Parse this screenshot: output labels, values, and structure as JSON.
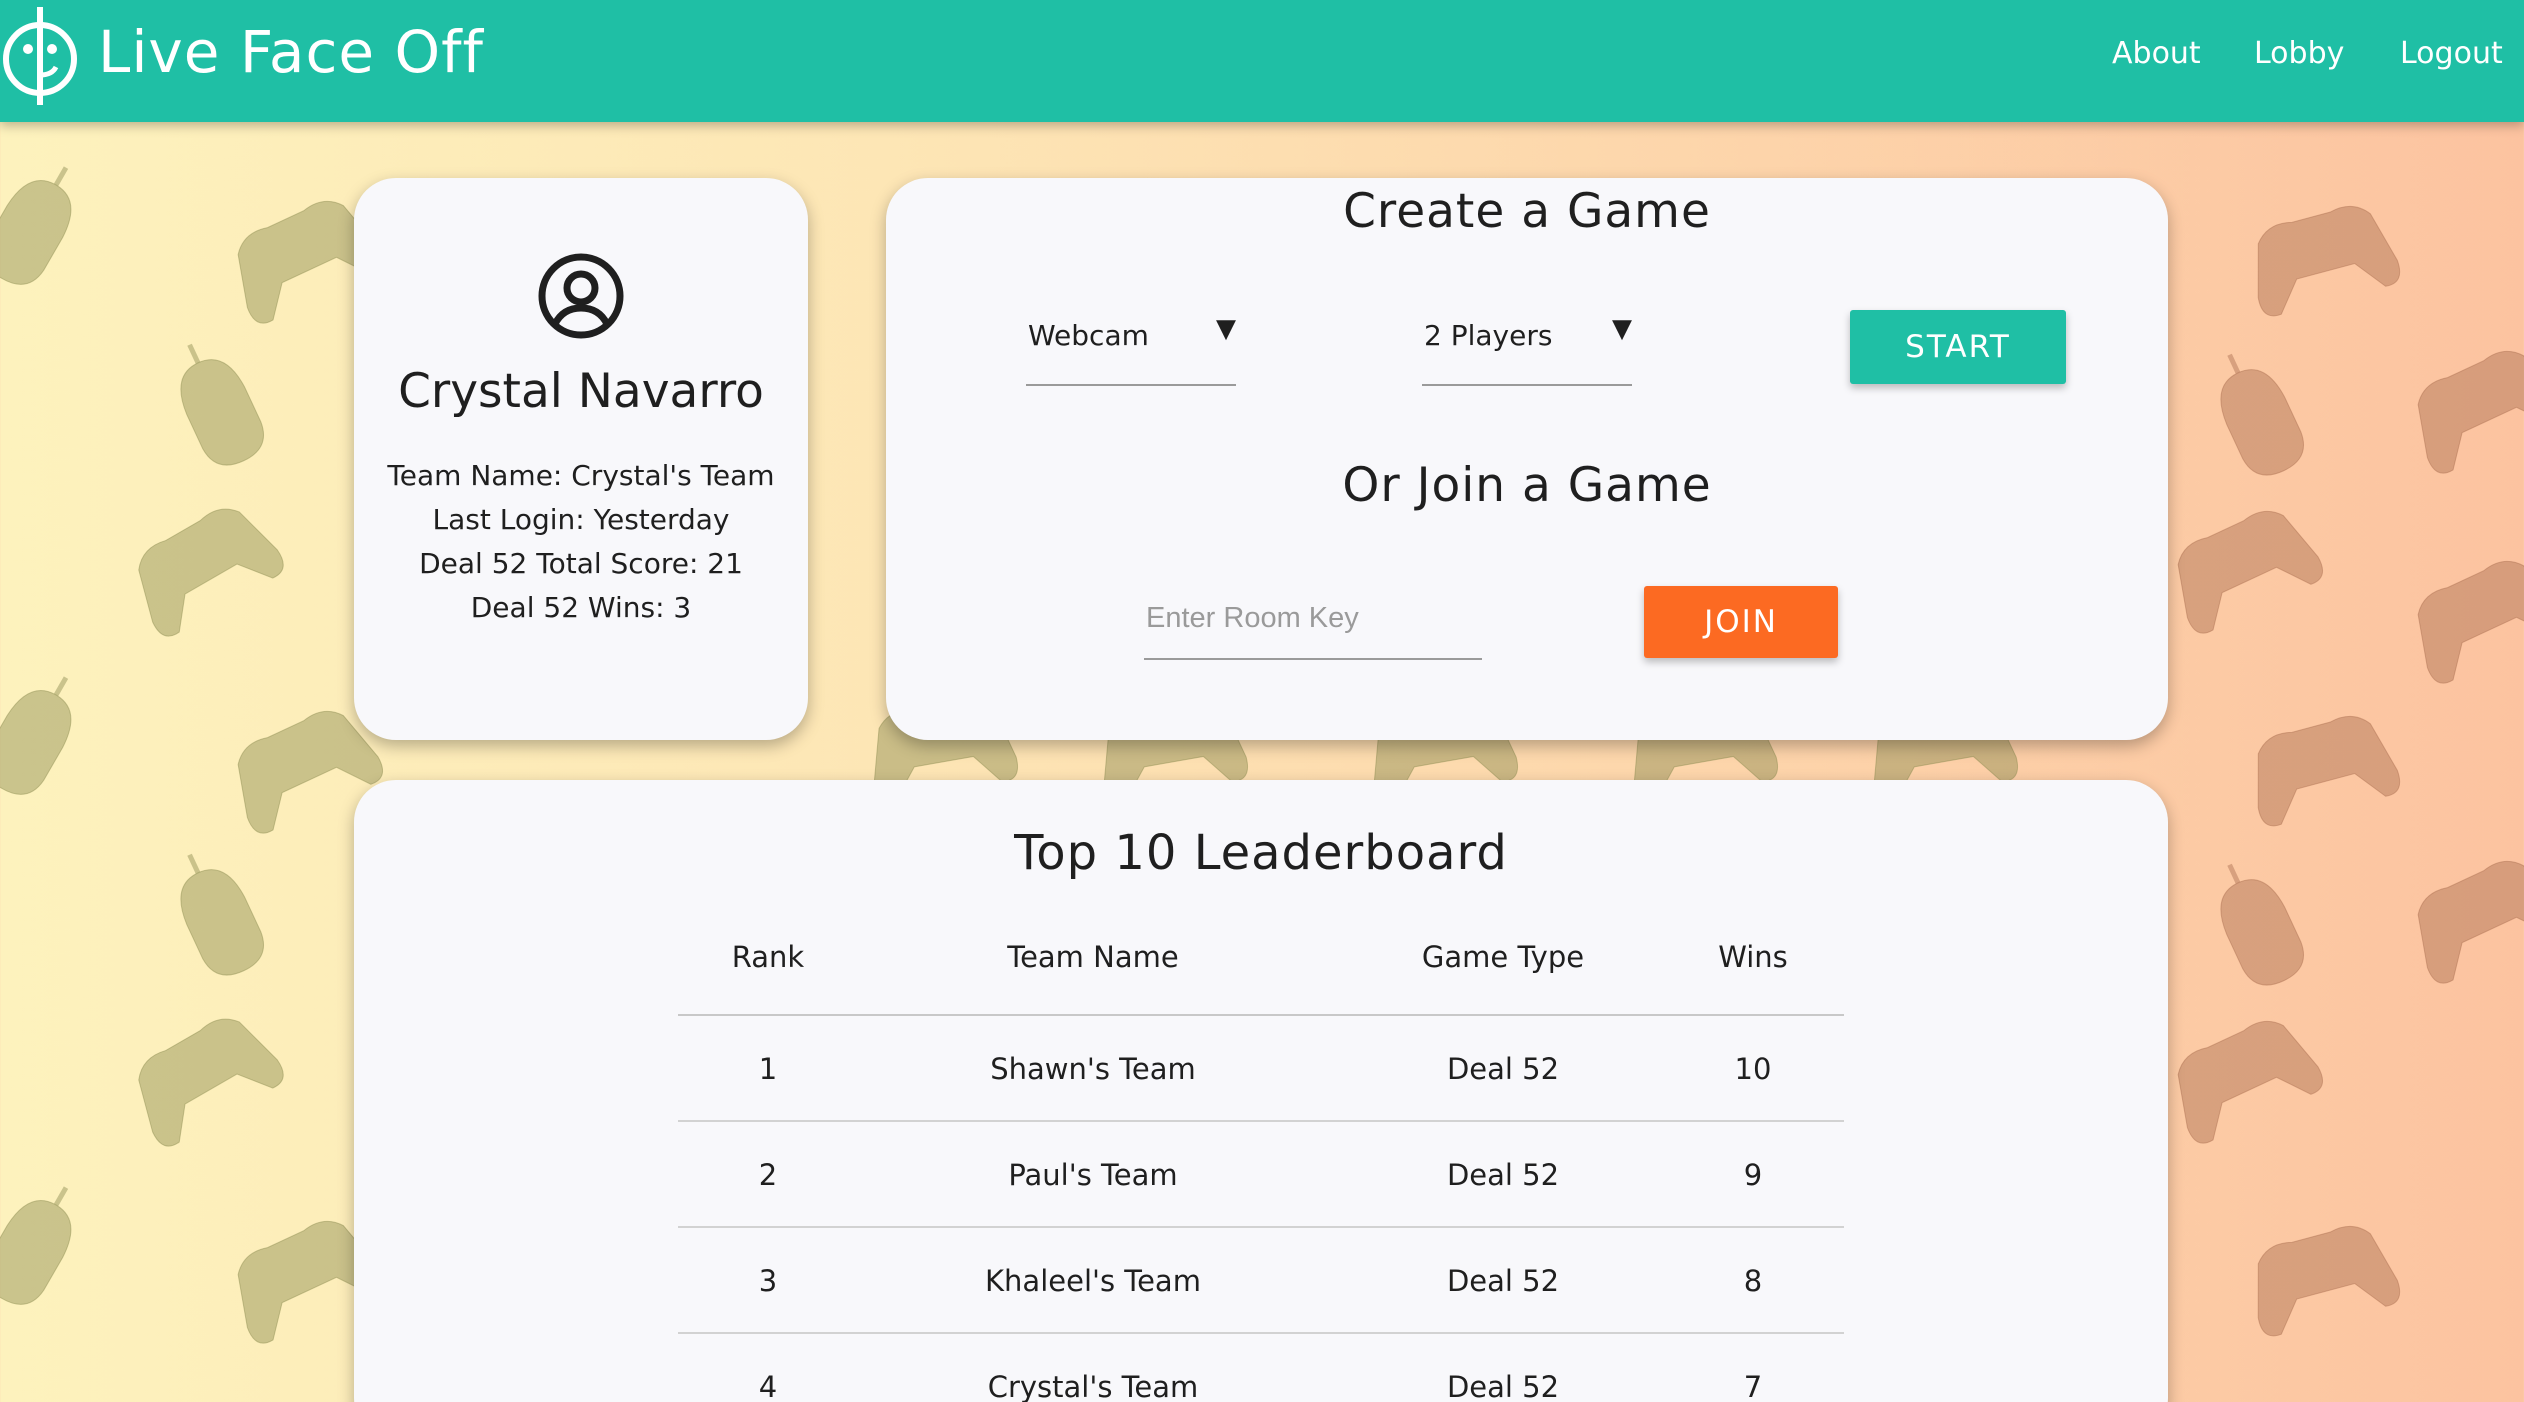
{
  "colors": {
    "brand": "#1fbfa5",
    "join": "#fc6a22",
    "card": "#f8f8fb"
  },
  "header": {
    "brand": "Live Face Off",
    "logo_icon": "face-logo-icon",
    "nav": [
      {
        "label": "About"
      },
      {
        "label": "Lobby"
      },
      {
        "label": "Logout"
      }
    ]
  },
  "profile": {
    "avatar_icon": "user-circle-icon",
    "name": "Crystal Navarro",
    "team_name": "Team Name: Crystal's Team",
    "last_login": "Last Login: Yesterday",
    "total_score": "Deal 52 Total Score: 21",
    "wins": "Deal 52 Wins: 3"
  },
  "create": {
    "title": "Create a Game",
    "mode_select": "Webcam",
    "players_select": "2 Players",
    "start_label": "START",
    "dropdown_icon": "triangle-down-icon"
  },
  "join": {
    "title": "Or Join a Game",
    "room_placeholder": "Enter Room Key",
    "join_label": "JOIN"
  },
  "leaderboard": {
    "title": "Top 10 Leaderboard",
    "columns": [
      "Rank",
      "Team Name",
      "Game Type",
      "Wins"
    ],
    "rows": [
      [
        "1",
        "Shawn's Team",
        "Deal 52",
        "10"
      ],
      [
        "2",
        "Paul's Team",
        "Deal 52",
        "9"
      ],
      [
        "3",
        "Khaleel's Team",
        "Deal 52",
        "8"
      ],
      [
        "4",
        "Crystal's Team",
        "Deal 52",
        "7"
      ]
    ]
  },
  "background": {
    "pattern_icons": [
      "gamepad-icon",
      "mouse-icon"
    ]
  }
}
